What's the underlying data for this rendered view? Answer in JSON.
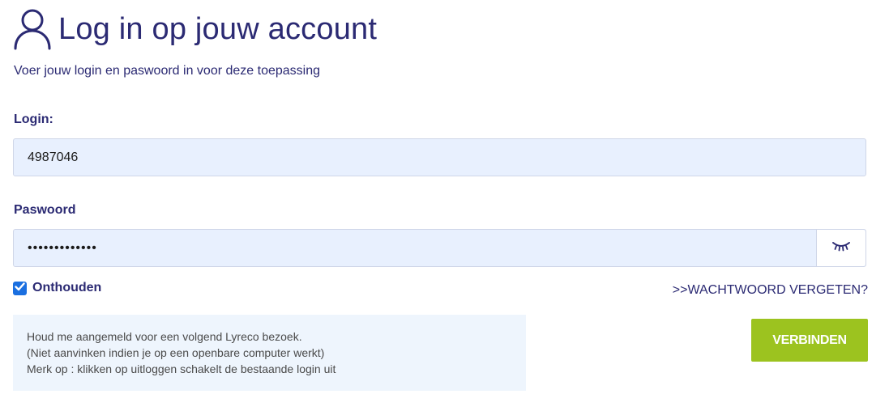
{
  "header": {
    "title": "Log in op jouw account",
    "subtitle": "Voer jouw login en paswoord in voor deze toepassing"
  },
  "login": {
    "label": "Login:",
    "value": "4987046"
  },
  "password": {
    "label": "Paswoord",
    "value": "•••••••••••••"
  },
  "remember": {
    "label": "Onthouden",
    "checked": true
  },
  "forgot_link": ">>WACHTWOORD VERGETEN?",
  "info": {
    "lines": [
      "Houd me aangemeld voor een volgend Lyreco bezoek.",
      "(Niet aanvinken indien je op een openbare computer werkt)",
      "Merk op : klikken op uitloggen schakelt de bestaande login uit"
    ]
  },
  "submit_label": "VERBINDEN",
  "icons": {
    "user": "user-outline-icon",
    "eye": "eye-closed-icon",
    "check": "checkmark-icon"
  },
  "colors": {
    "primary_text": "#2b2a73",
    "input_bg": "#e8f0fe",
    "button_bg": "#9cc31f",
    "checkbox": "#1a6fe0",
    "info_bg": "#eef5fd"
  }
}
